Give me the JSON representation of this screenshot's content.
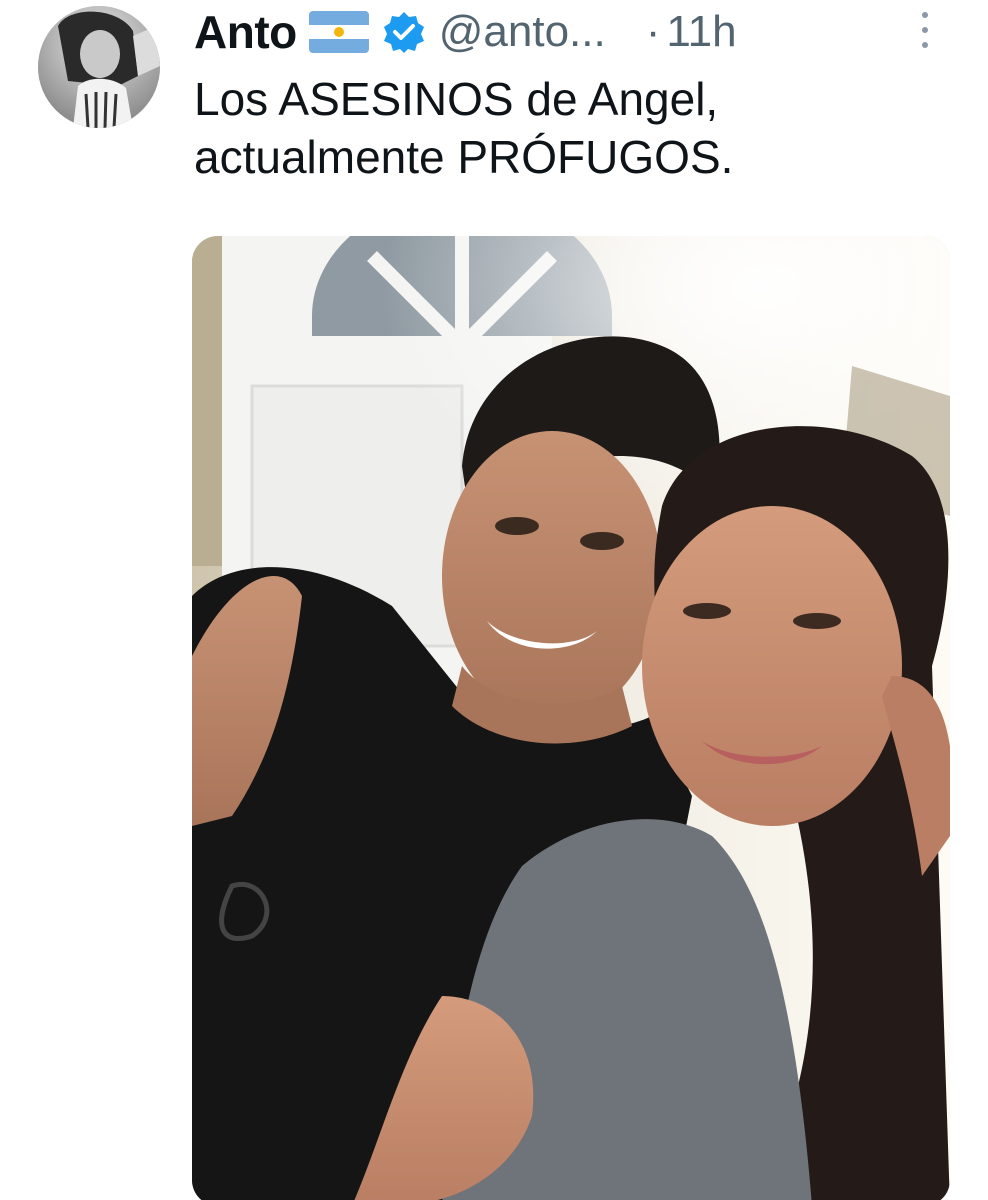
{
  "tweet": {
    "author": {
      "display_name": "Anto",
      "handle": "@anto...",
      "avatar_icon": "avatar-photo",
      "flag_icon": "argentina-flag-icon",
      "verified_icon": "verified-badge-icon"
    },
    "separator": "·",
    "timestamp": "11h",
    "text_lines": [
      "Los ASESINOS de Angel,",
      "actualmente PRÓFUGOS."
    ],
    "media": {
      "type": "photo",
      "description_icon": "selfie-photo"
    },
    "more_icon": "vertical-ellipsis-icon"
  },
  "colors": {
    "text_primary": "#0f1419",
    "text_secondary": "#536471",
    "verified_blue": "#1d9bf0",
    "flag_blue": "#74acdf",
    "flag_sun": "#f6b40e"
  }
}
